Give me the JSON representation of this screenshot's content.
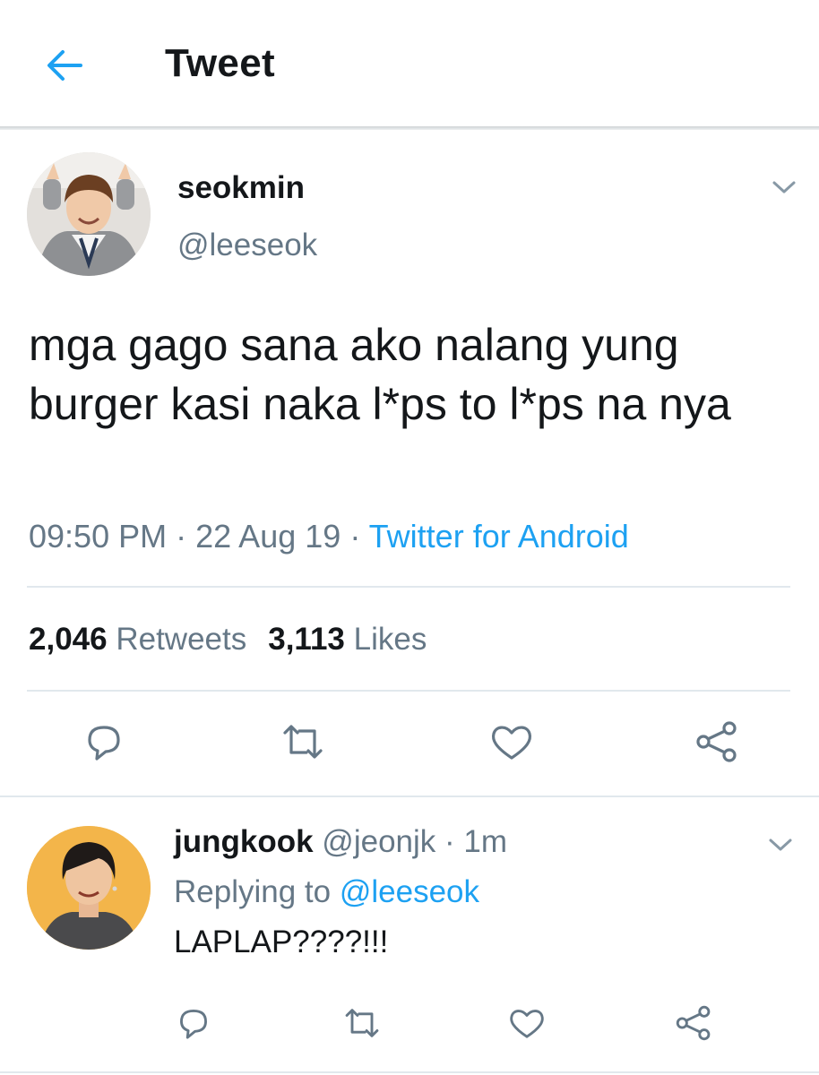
{
  "header": {
    "title": "Tweet",
    "back_icon": "arrow-left-icon"
  },
  "tweet": {
    "display_name": "seokmin",
    "handle": "@leeseok",
    "text": "mga gago sana ako nalang yung burger kasi naka l*ps to l*ps na nya",
    "time": "09:50 PM",
    "date": "22 Aug 19",
    "source": "Twitter for Android",
    "separator": "·",
    "retweets_count": "2,046",
    "retweets_label": "Retweets",
    "likes_count": "3,113",
    "likes_label": "Likes",
    "actions": [
      "reply-icon",
      "retweet-icon",
      "like-icon",
      "share-icon"
    ]
  },
  "reply": {
    "display_name": "jungkook",
    "handle": "@jeonjk",
    "separator": "·",
    "time_ago": "1m",
    "replying_prefix": "Replying to",
    "replying_to": "@leeseok",
    "text": "LAPLAP????!!!"
  },
  "colors": {
    "accent": "#1da1f2",
    "secondary_text": "#657786",
    "primary_text": "#14171a",
    "divider": "#e1e8ed"
  }
}
